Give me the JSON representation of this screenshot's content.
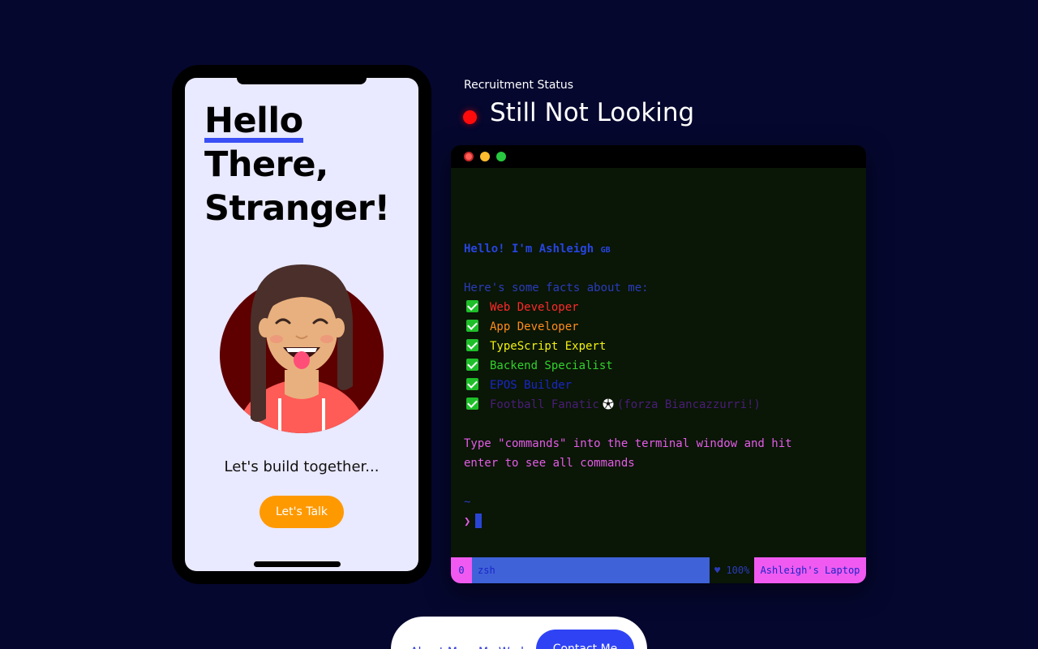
{
  "phone": {
    "title_hello": "Hello",
    "title_line2": "There,",
    "title_line3": "Stranger!",
    "tagline": "Let's build together...",
    "cta_label": "Let's Talk"
  },
  "status": {
    "label": "Recruitment Status",
    "value": "Still Not Looking",
    "indicator_color": "#ff0b0b"
  },
  "terminal": {
    "greeting": "Hello! I'm Ashleigh ",
    "greeting_flag": "GB",
    "facts_intro": "Here's some facts about me:",
    "facts": [
      {
        "text": "Web Developer",
        "color": "#ff2a2a"
      },
      {
        "text": "App Developer",
        "color": "#ff8c1a"
      },
      {
        "text": "TypeScript Expert",
        "color": "#f2f20f"
      },
      {
        "text": "Backend Specialist",
        "color": "#32d12c"
      },
      {
        "text": "EPOS Builder",
        "color": "#1a26c8"
      },
      {
        "text": "Football Fanatic",
        "color": "#4a1d7a"
      }
    ],
    "football_note": "(forza Biancazzurri!)",
    "instruction_line1": "Type \"commands\" into the terminal window and hit",
    "instruction_line2": "enter to see all commands",
    "cwd": "~",
    "prompt_symbol": "❯",
    "statusbar": {
      "window_index": "0",
      "shell": "zsh",
      "battery": "♥ 100%",
      "host": "Ashleigh's Laptop"
    }
  },
  "nav": {
    "about": "About Me",
    "work": "My Work",
    "contact": "Contact Me"
  }
}
